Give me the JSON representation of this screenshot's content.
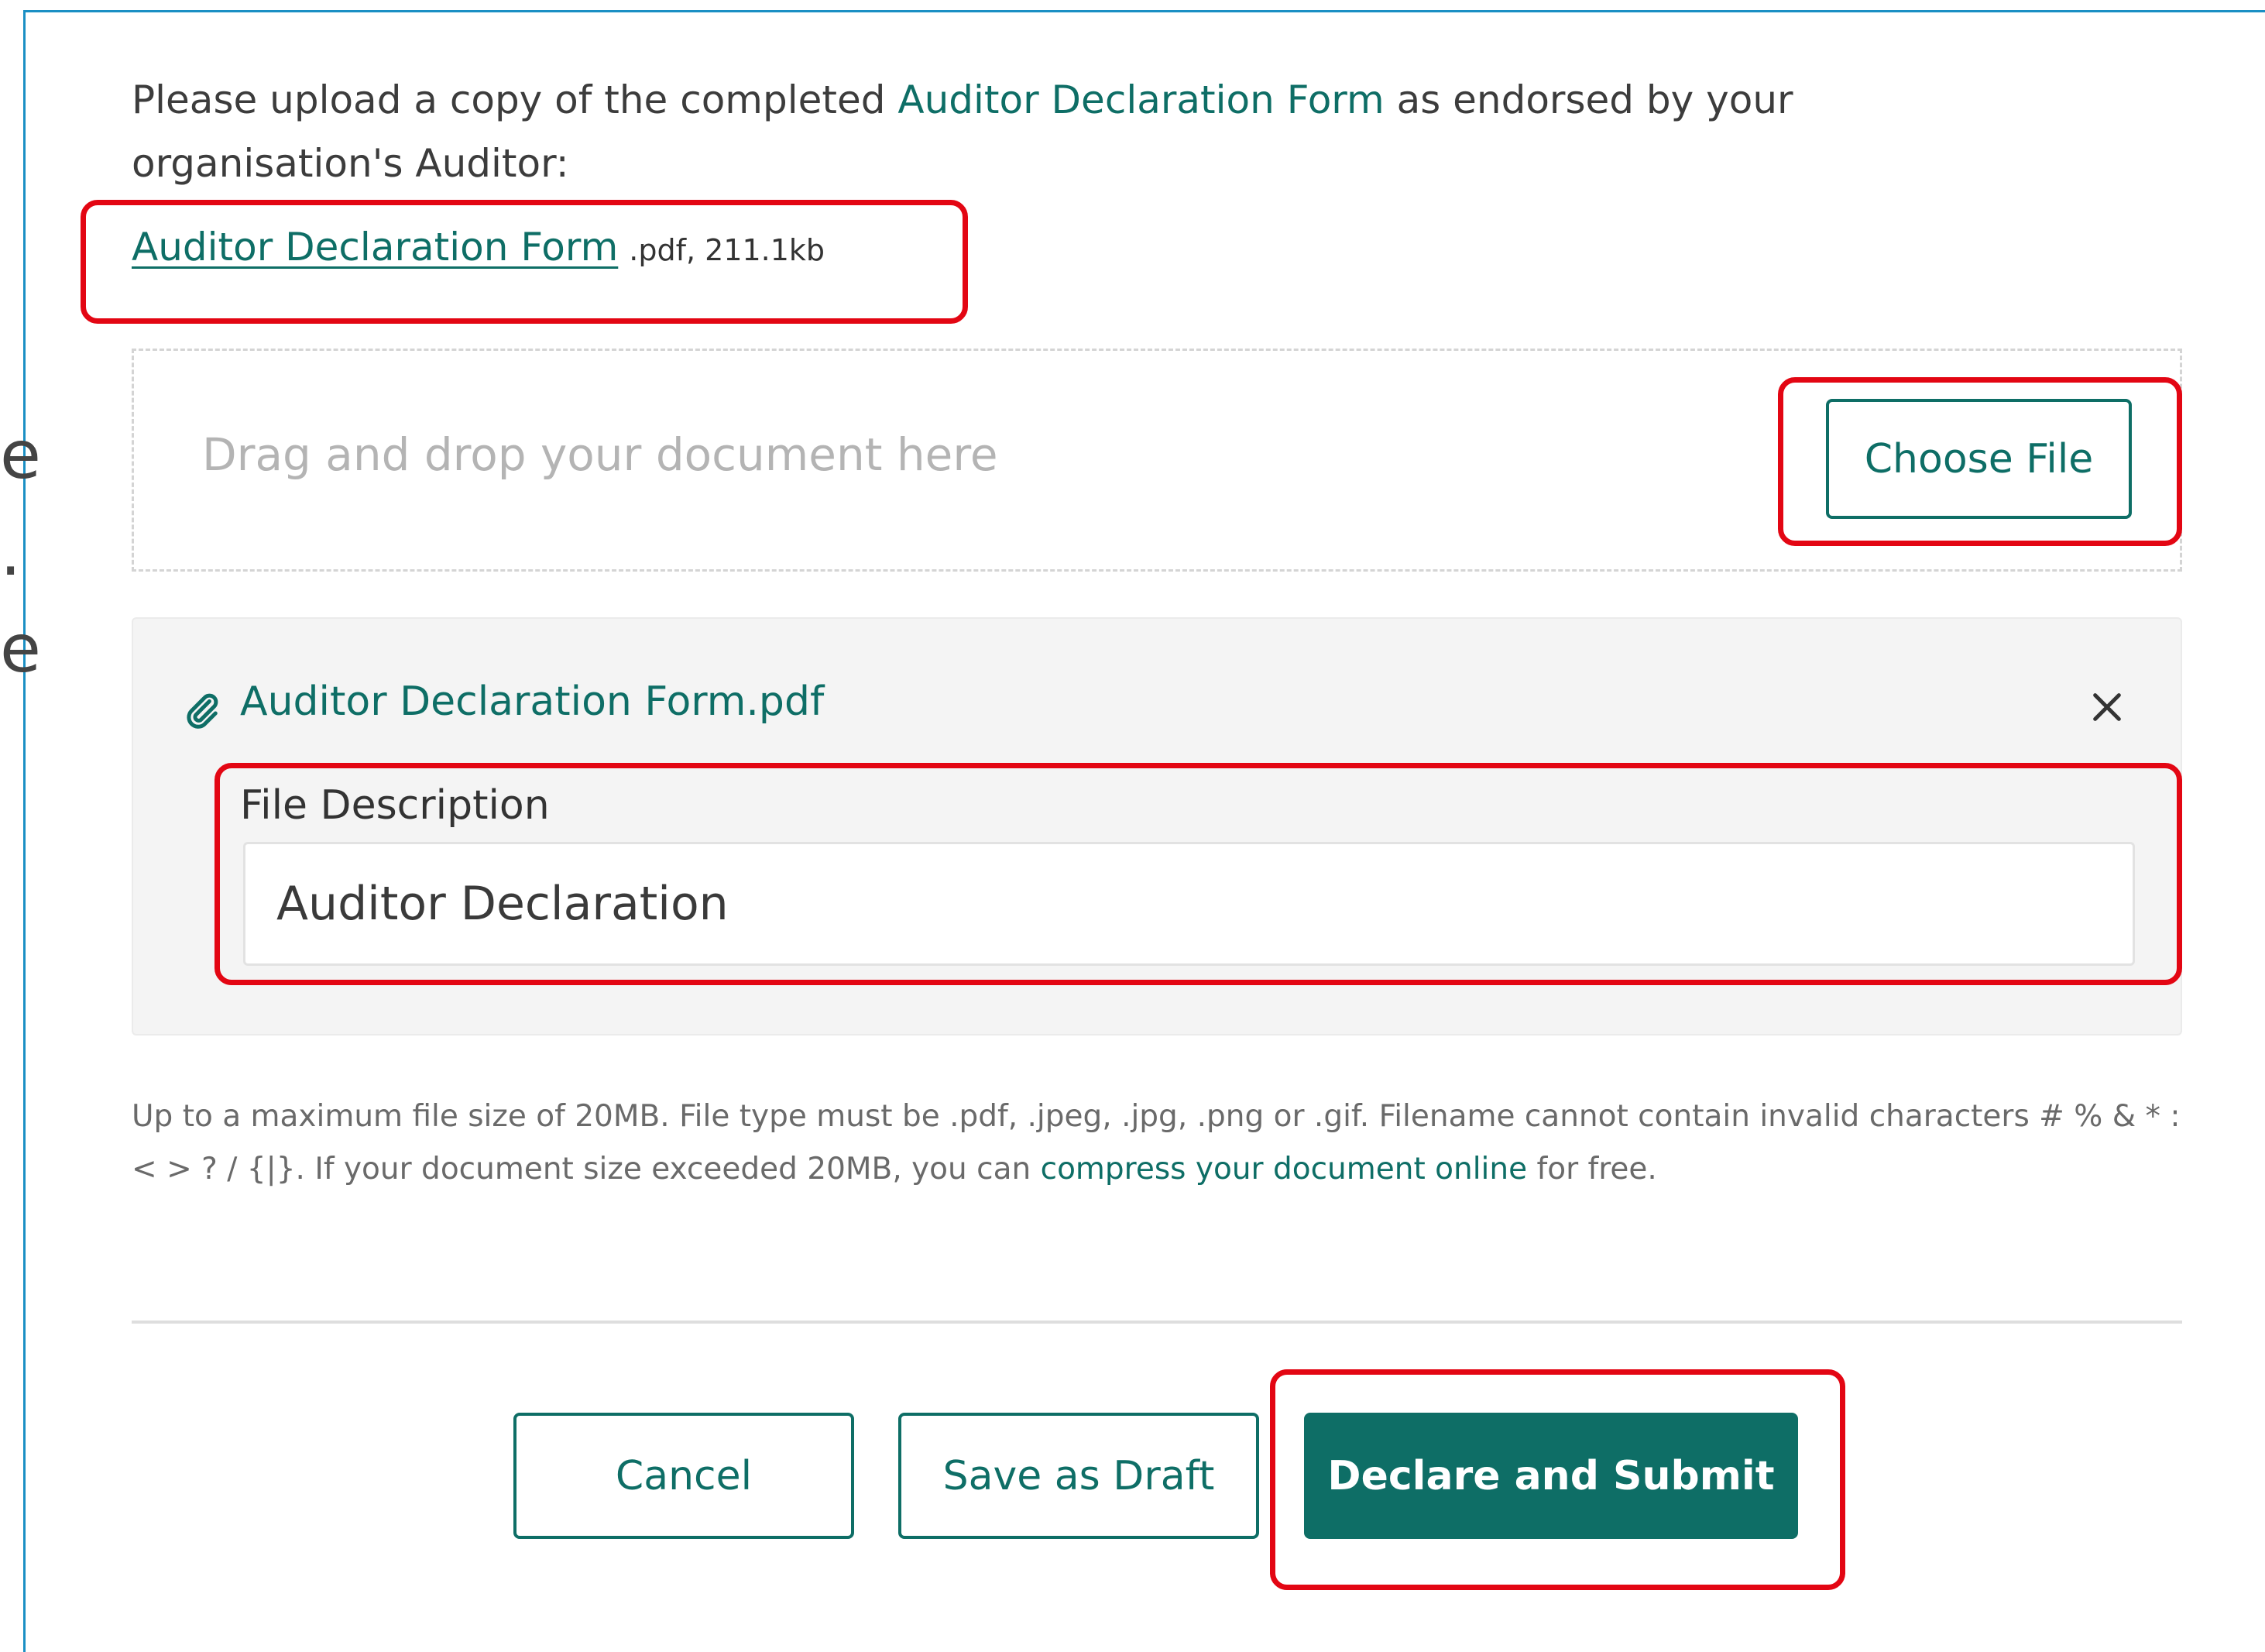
{
  "edge_glyphs": [
    "e",
    ".",
    "e"
  ],
  "intro": {
    "part1": "Please upload a copy of the completed ",
    "accent": "Auditor Declaration Form",
    "part2": " as endorsed by your organisation's Auditor:"
  },
  "form_link": {
    "label": "Auditor Declaration Form",
    "meta": ".pdf, 211.1kb"
  },
  "dropzone": {
    "text": "Drag and drop your document here",
    "choose_label": "Choose File"
  },
  "uploaded_file": {
    "name": "Auditor Declaration Form.pdf",
    "description_label": "File Description",
    "description_value": "Auditor Declaration"
  },
  "help": {
    "text": "Up to a maximum file size of 20MB. File type must be .pdf, .jpeg, .jpg, .png or .gif. Filename cannot contain invalid characters # % & * : < > ? / {|}. If your document size exceeded 20MB, you can ",
    "link": "compress your document online",
    "suffix": " for free."
  },
  "actions": {
    "cancel": "Cancel",
    "save_draft": "Save as Draft",
    "submit": "Declare and Submit"
  },
  "colors": {
    "accent": "#0e6e66",
    "highlight": "#e30613",
    "frame": "#1a8fc4"
  },
  "icons": {
    "attachment": "paperclip-icon",
    "remove": "close-icon"
  }
}
